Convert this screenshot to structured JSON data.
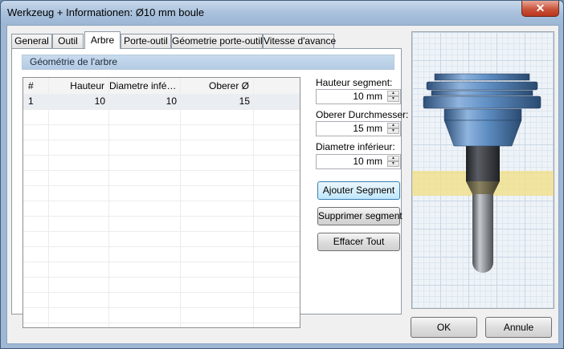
{
  "window": {
    "title": "Werkzeug + Informationen: Ø10 mm boule",
    "close_glyph": "✕"
  },
  "tabs": [
    {
      "label": "General"
    },
    {
      "label": "Outil"
    },
    {
      "label": "Arbre",
      "active": true
    },
    {
      "label": "Porte-outil"
    },
    {
      "label": "Géometrie porte-outil"
    },
    {
      "label": "Vitesse d'avance"
    }
  ],
  "group_title": "Géométrie de l'arbre",
  "table": {
    "columns": [
      "#",
      "Hauteur",
      "Diametre infé…",
      "Oberer  Ø"
    ],
    "rows": [
      {
        "num": "1",
        "hauteur": "10",
        "diametre_inf": "10",
        "oberer": "15"
      }
    ]
  },
  "fields": {
    "hauteur_segment": {
      "label": "Hauteur segment:",
      "value": "10 mm"
    },
    "oberer_durchmesser": {
      "label": "Oberer Durchmesser:",
      "value": "15 mm"
    },
    "diametre_inferieur": {
      "label": "Diametre inférieur:",
      "value": "10 mm"
    }
  },
  "buttons": {
    "ajouter": "Ajouter Segment",
    "supprimer": "Supprimer segment",
    "effacer": "Effacer Tout",
    "ok": "OK",
    "annule": "Annule"
  },
  "icons": {
    "spin_up": "▲",
    "spin_down": "▼"
  },
  "colors": {
    "highlight_band": "#f1e08a",
    "holder_blue": "#5f8fc4",
    "shaft_dark": "#3a3d42",
    "tool_gray": "#8a8d92"
  }
}
